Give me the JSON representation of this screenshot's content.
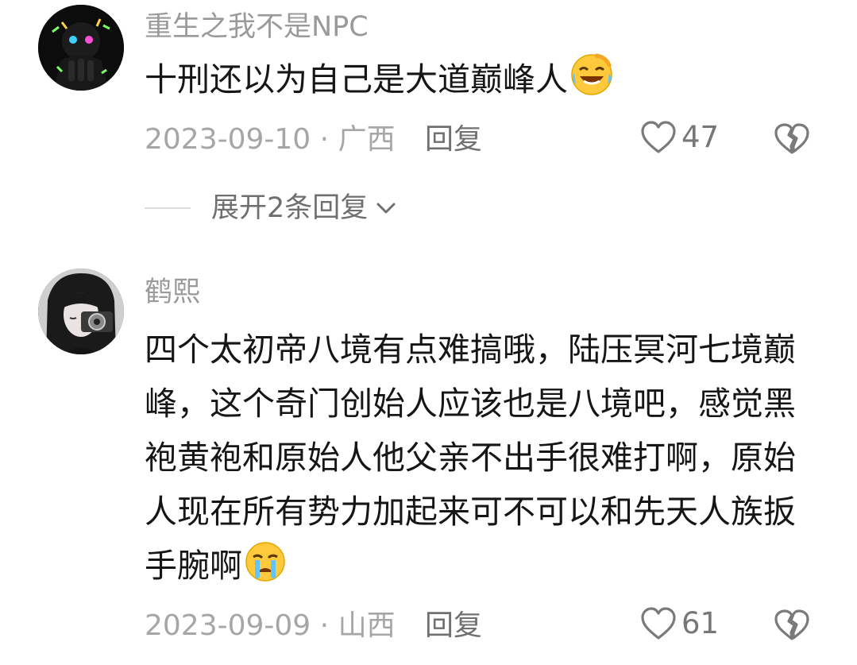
{
  "comments": [
    {
      "username": "重生之我不是NPC",
      "text": "十刑还以为自己是大道巅峰人",
      "emoji": "laughing-tears-emoji",
      "date": "2023-09-10",
      "separator": " · ",
      "region": "广西",
      "reply_label": "回复",
      "likes": "47"
    },
    {
      "username": "鹤熙",
      "text": "四个太初帝八境有点难搞哦，陆压冥河七境巅峰，这个奇门创始人应该也是八境吧，感觉黑袍黄袍和原始人他父亲不出手很难打啊，原始人现在所有势力加起来可不可以和先天人族扳手腕啊",
      "emoji": "crying-emoji",
      "date": "2023-09-09",
      "separator": " · ",
      "region": "山西",
      "reply_label": "回复",
      "likes": "61"
    }
  ],
  "expand_replies": {
    "label": "展开2条回复"
  },
  "icons": {
    "like": "heart-outline-icon",
    "dislike": "broken-heart-icon",
    "expand": "chevron-down-icon"
  },
  "colors": {
    "username": "#9a9a9a",
    "text": "#161616",
    "meta": "#a6a6a6",
    "icon": "#7a7a7a"
  }
}
